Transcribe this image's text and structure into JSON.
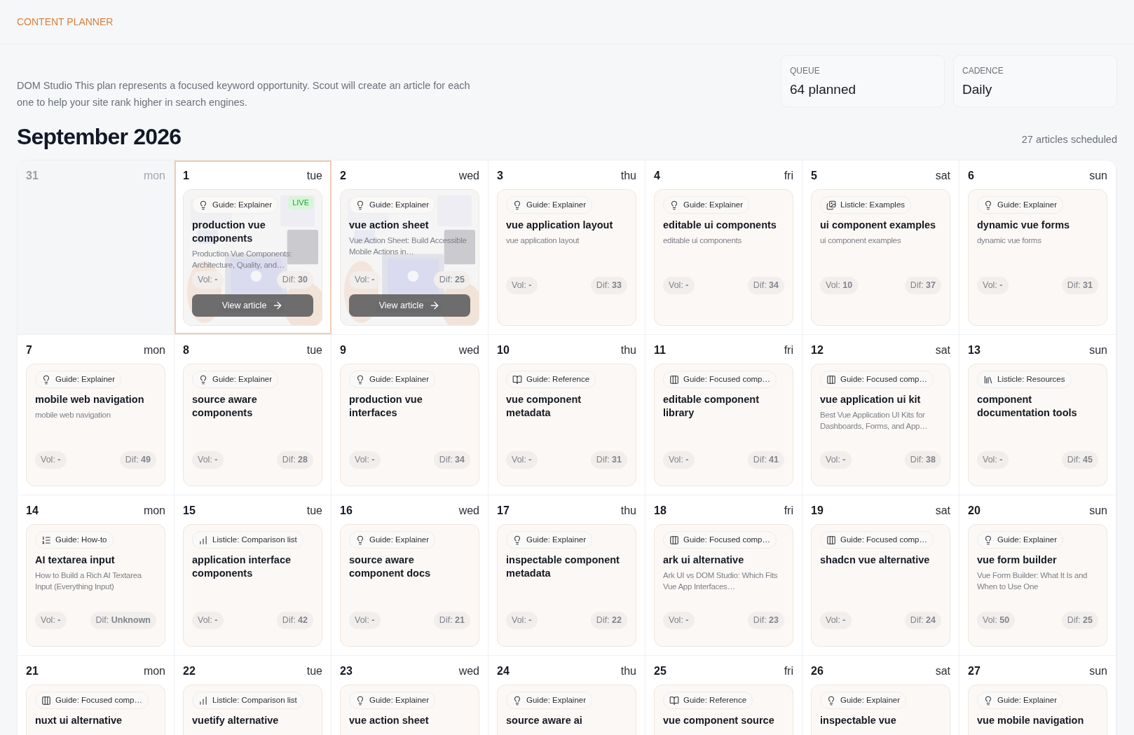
{
  "header": {
    "title": "CONTENT PLANNER"
  },
  "intro": "DOM Studio This plan represents a focused keyword opportunity. Scout will create an article for each one to help your site rank higher in search engines.",
  "stats": [
    {
      "label": "QUEUE",
      "value": "64 planned"
    },
    {
      "label": "CADENCE",
      "value": "Daily"
    }
  ],
  "calendar": {
    "month": "September 2026",
    "summary": "27 articles scheduled",
    "weeks": [
      [
        {
          "day": "31",
          "weekday": "mon",
          "outside": true,
          "selected": false
        },
        {
          "day": "1",
          "weekday": "tue",
          "outside": false,
          "selected": true,
          "article": {
            "kind": "bulb",
            "category": "Guide: Explainer",
            "live": "LIVE",
            "image": true,
            "title": "production vue components",
            "description": "Production Vue Components: Architecture, Quality, and…",
            "vol": "Vol: **-**",
            "dif": "Dif: **30**",
            "action": "View article"
          }
        },
        {
          "day": "2",
          "weekday": "wed",
          "outside": false,
          "selected": false,
          "article": {
            "kind": "bulb",
            "category": "Guide: Explainer",
            "image": true,
            "title": "vue action sheet",
            "description": "Vue Action Sheet: Build Accessible Mobile Actions in…",
            "vol": "Vol: **-**",
            "dif": "Dif: **25**",
            "action": "View article"
          }
        },
        {
          "day": "3",
          "weekday": "thu",
          "outside": false,
          "selected": false,
          "article": {
            "kind": "bulb",
            "category": "Guide: Explainer",
            "title": "vue application layout",
            "description": "vue application layout",
            "vol": "Vol: **-**",
            "dif": "Dif: **33**"
          }
        },
        {
          "day": "4",
          "weekday": "fri",
          "outside": false,
          "selected": false,
          "article": {
            "kind": "bulb",
            "category": "Guide: Explainer",
            "title": "editable ui components",
            "description": "editable ui components",
            "vol": "Vol: **-**",
            "dif": "Dif: **34**"
          }
        },
        {
          "day": "5",
          "weekday": "sat",
          "outside": false,
          "selected": false,
          "article": {
            "kind": "images",
            "category": "Listicle: Examples",
            "title": "ui component examples",
            "description": "ui component examples",
            "vol": "Vol: **10**",
            "dif": "Dif: **37**"
          }
        },
        {
          "day": "6",
          "weekday": "sun",
          "outside": false,
          "selected": false,
          "article": {
            "kind": "bulb",
            "category": "Guide: Explainer",
            "title": "dynamic vue forms",
            "description": "dynamic vue forms",
            "vol": "Vol: **-**",
            "dif": "Dif: **31**"
          }
        }
      ],
      [
        {
          "day": "7",
          "weekday": "mon",
          "outside": false,
          "selected": false,
          "article": {
            "kind": "bulb",
            "category": "Guide: Explainer",
            "title": "mobile web navigation",
            "description": "mobile web navigation",
            "vol": "Vol: **-**",
            "dif": "Dif: **49**"
          }
        },
        {
          "day": "8",
          "weekday": "tue",
          "outside": false,
          "selected": false,
          "article": {
            "kind": "bulb",
            "category": "Guide: Explainer",
            "title": "source aware components",
            "vol": "Vol: **-**",
            "dif": "Dif: **28**"
          }
        },
        {
          "day": "9",
          "weekday": "wed",
          "outside": false,
          "selected": false,
          "article": {
            "kind": "bulb",
            "category": "Guide: Explainer",
            "title": "production vue interfaces",
            "vol": "Vol: **-**",
            "dif": "Dif: **34**"
          }
        },
        {
          "day": "10",
          "weekday": "thu",
          "outside": false,
          "selected": false,
          "article": {
            "kind": "book",
            "category": "Guide: Reference",
            "title": "vue component metadata",
            "vol": "Vol: **-**",
            "dif": "Dif: **31**"
          }
        },
        {
          "day": "11",
          "weekday": "fri",
          "outside": false,
          "selected": false,
          "article": {
            "kind": "columns",
            "category": "Guide: Focused comp…",
            "title": "editable component library",
            "vol": "Vol: **-**",
            "dif": "Dif: **41**"
          }
        },
        {
          "day": "12",
          "weekday": "sat",
          "outside": false,
          "selected": false,
          "article": {
            "kind": "columns",
            "category": "Guide: Focused comp…",
            "title": "vue application ui kit",
            "description": "Best Vue Application UI Kits for Dashboards, Forms, and App…",
            "vol": "Vol: **-**",
            "dif": "Dif: **38**"
          }
        },
        {
          "day": "13",
          "weekday": "sun",
          "outside": false,
          "selected": false,
          "article": {
            "kind": "library",
            "category": "Listicle: Resources",
            "title": "component documentation tools",
            "vol": "Vol: **-**",
            "dif": "Dif: **45**"
          }
        }
      ],
      [
        {
          "day": "14",
          "weekday": "mon",
          "outside": false,
          "selected": false,
          "article": {
            "kind": "list",
            "category": "Guide: How-to",
            "title": "AI textarea input",
            "description": "How to Build a Rich AI Textarea Input (Everything Input)",
            "vol": "Vol: **-**",
            "dif": "Dif: **Unknown**"
          }
        },
        {
          "day": "15",
          "weekday": "tue",
          "outside": false,
          "selected": false,
          "article": {
            "kind": "chart",
            "category": "Listicle: Comparison list",
            "title": "application interface components",
            "vol": "Vol: **-**",
            "dif": "Dif: **42**"
          }
        },
        {
          "day": "16",
          "weekday": "wed",
          "outside": false,
          "selected": false,
          "article": {
            "kind": "bulb",
            "category": "Guide: Explainer",
            "title": "source aware component docs",
            "vol": "Vol: **-**",
            "dif": "Dif: **21**"
          }
        },
        {
          "day": "17",
          "weekday": "thu",
          "outside": false,
          "selected": false,
          "article": {
            "kind": "bulb",
            "category": "Guide: Explainer",
            "title": "inspectable component metadata",
            "vol": "Vol: **-**",
            "dif": "Dif: **22**"
          }
        },
        {
          "day": "18",
          "weekday": "fri",
          "outside": false,
          "selected": false,
          "article": {
            "kind": "columns",
            "category": "Guide: Focused comp…",
            "title": "ark ui alternative",
            "description": "Ark UI vs DOM Studio: Which Fits Vue App Interfaces…",
            "vol": "Vol: **-**",
            "dif": "Dif: **23**"
          }
        },
        {
          "day": "19",
          "weekday": "sat",
          "outside": false,
          "selected": false,
          "article": {
            "kind": "columns",
            "category": "Guide: Focused comp…",
            "title": "shadcn vue alternative",
            "vol": "Vol: **-**",
            "dif": "Dif: **24**"
          }
        },
        {
          "day": "20",
          "weekday": "sun",
          "outside": false,
          "selected": false,
          "article": {
            "kind": "bulb",
            "category": "Guide: Explainer",
            "title": "vue form builder",
            "description": "Vue Form Builder: What It Is and When to Use One",
            "vol": "Vol: **50**",
            "dif": "Dif: **25**"
          }
        }
      ],
      [
        {
          "day": "21",
          "weekday": "mon",
          "outside": false,
          "selected": false,
          "article": {
            "kind": "columns",
            "category": "Guide: Focused comp…",
            "title": "nuxt ui alternative"
          }
        },
        {
          "day": "22",
          "weekday": "tue",
          "outside": false,
          "selected": false,
          "article": {
            "kind": "chart",
            "category": "Listicle: Comparison list",
            "title": "vuetify alternative"
          }
        },
        {
          "day": "23",
          "weekday": "wed",
          "outside": false,
          "selected": false,
          "article": {
            "kind": "bulb",
            "category": "Guide: Explainer",
            "title": "vue action sheet"
          }
        },
        {
          "day": "24",
          "weekday": "thu",
          "outside": false,
          "selected": false,
          "article": {
            "kind": "bulb",
            "category": "Guide: Explainer",
            "title": "source aware ai"
          }
        },
        {
          "day": "25",
          "weekday": "fri",
          "outside": false,
          "selected": false,
          "article": {
            "kind": "book",
            "category": "Guide: Reference",
            "title": "vue component source"
          }
        },
        {
          "day": "26",
          "weekday": "sat",
          "outside": false,
          "selected": false,
          "article": {
            "kind": "bulb",
            "category": "Guide: Explainer",
            "title": "inspectable vue"
          }
        },
        {
          "day": "27",
          "weekday": "sun",
          "outside": false,
          "selected": false,
          "article": {
            "kind": "bulb",
            "category": "Guide: Explainer",
            "title": "vue mobile navigation"
          }
        }
      ]
    ]
  }
}
